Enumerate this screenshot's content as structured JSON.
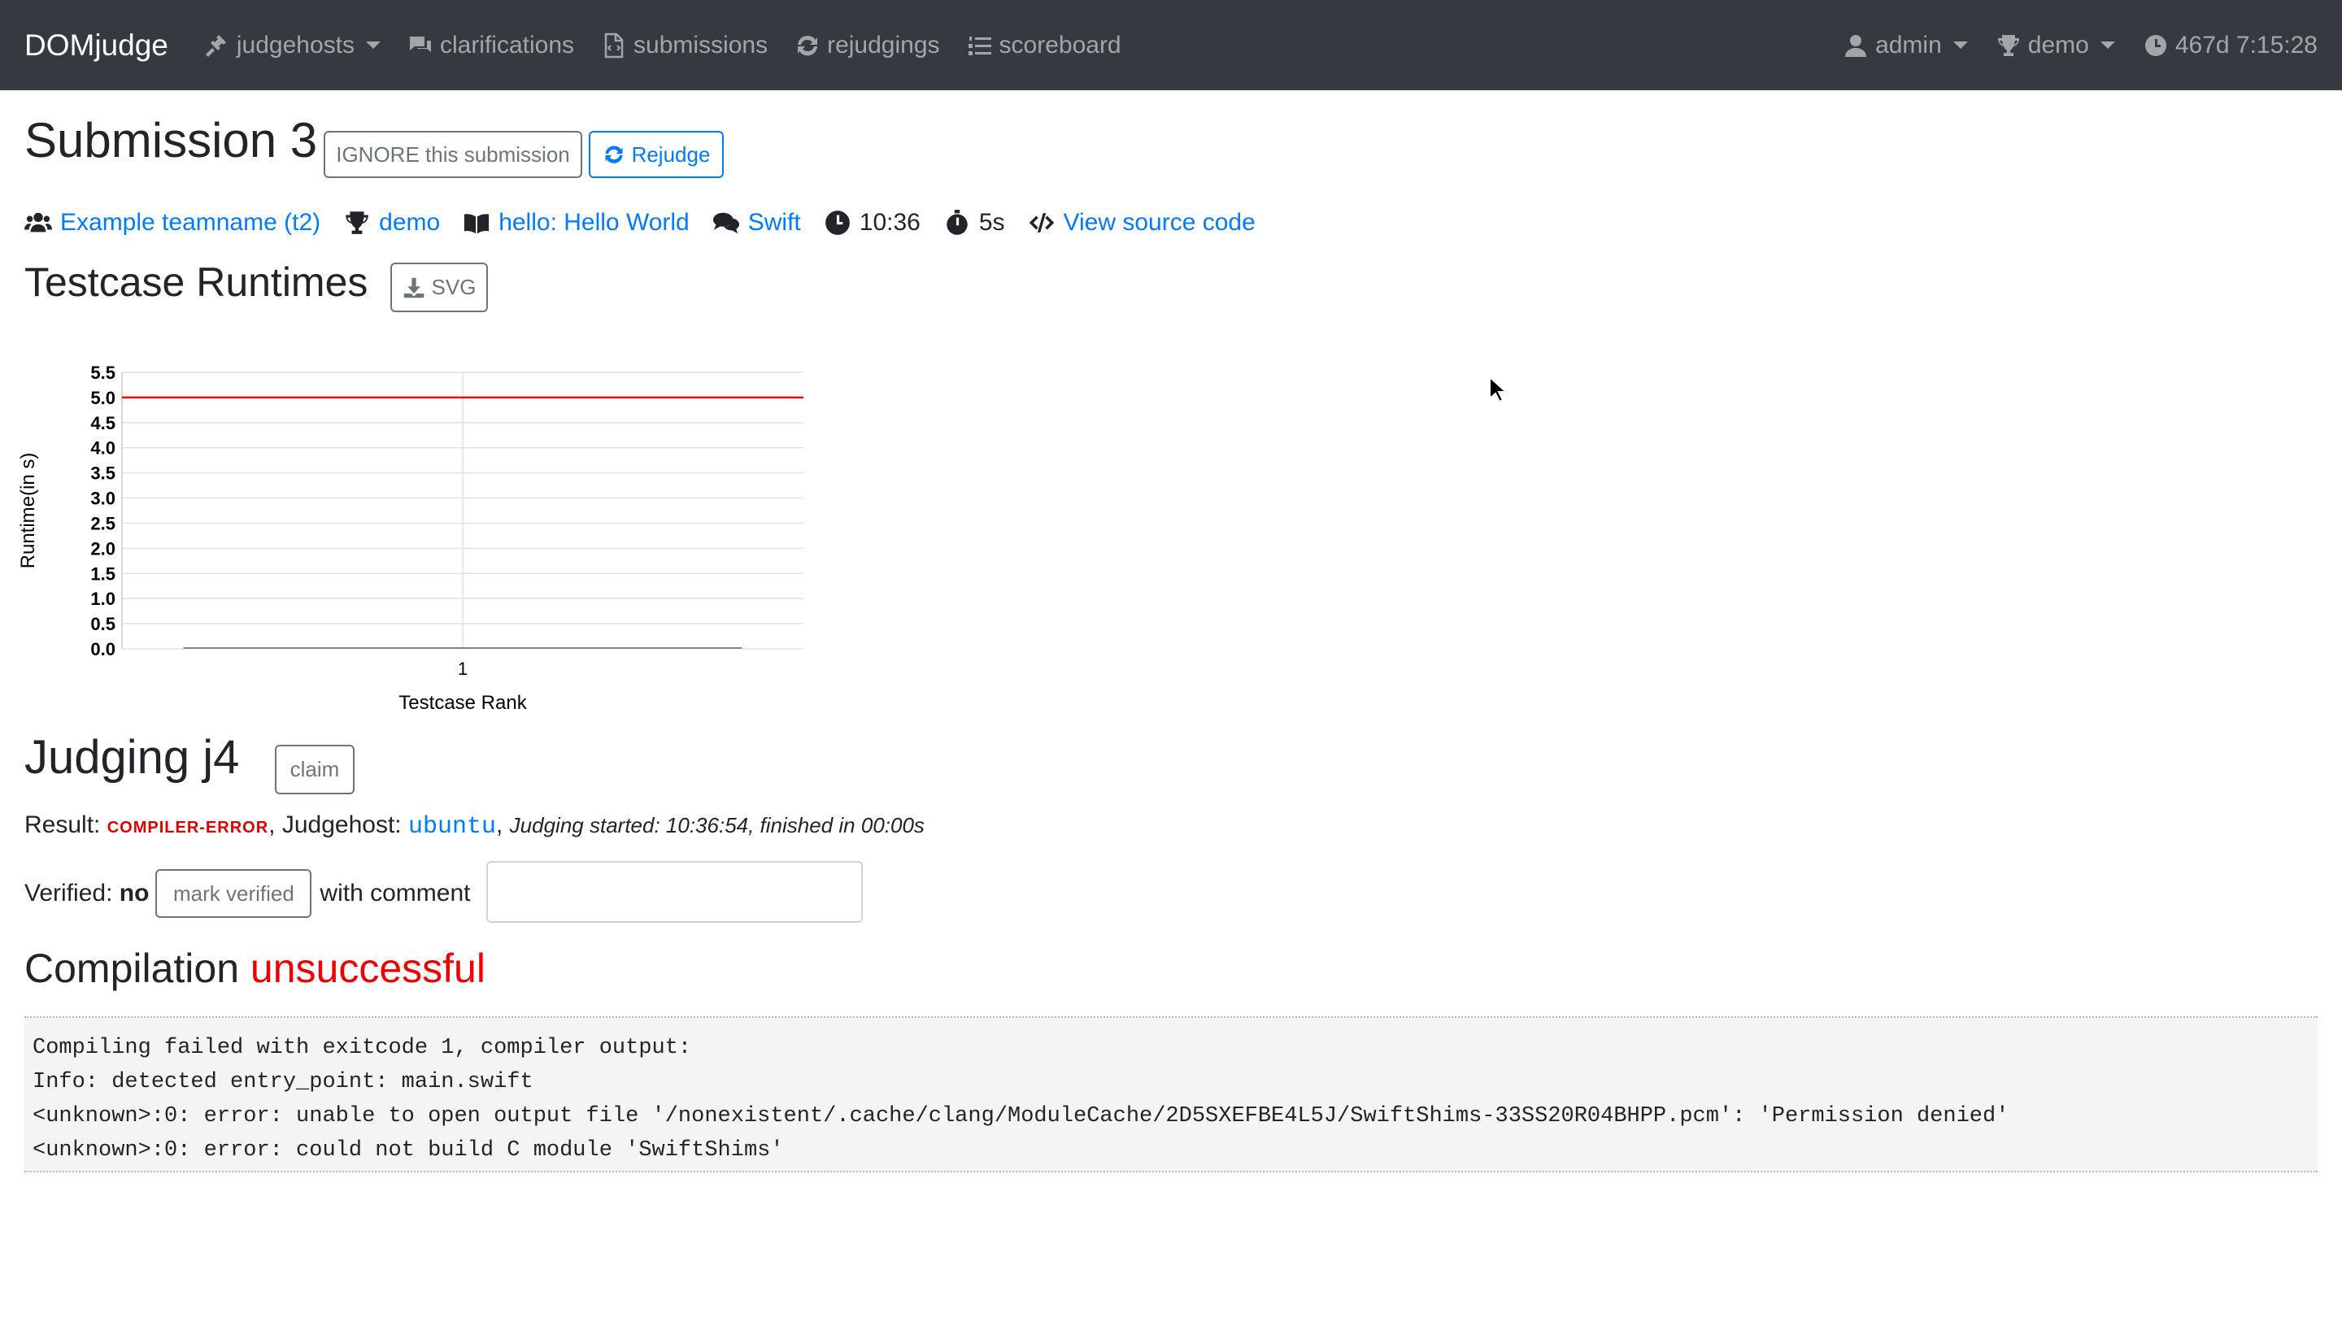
{
  "navbar": {
    "brand": "DOMjudge",
    "items": [
      {
        "label": "judgehosts",
        "icon": "gavel-icon",
        "dropdown": true
      },
      {
        "label": "clarifications",
        "icon": "comments-icon"
      },
      {
        "label": "submissions",
        "icon": "file-code-icon"
      },
      {
        "label": "rejudgings",
        "icon": "sync-icon"
      },
      {
        "label": "scoreboard",
        "icon": "list-ol-icon"
      }
    ],
    "user": "admin",
    "contest": "demo",
    "clock": "467d 7:15:28"
  },
  "submission": {
    "title": "Submission 3",
    "ignore_button": "IGNORE this submission",
    "rejudge_button": "Rejudge",
    "team": "Example teamname (t2)",
    "contest": "demo",
    "problem": "hello: Hello World",
    "language": "Swift",
    "time": "10:36",
    "runtime": "5s",
    "view_source": "View source code"
  },
  "runtimes": {
    "title": "Testcase Runtimes",
    "svg_button": "SVG"
  },
  "chart_data": {
    "type": "bar",
    "categories": [
      "1"
    ],
    "values": [
      0.0
    ],
    "timelimit": 5.0,
    "xlabel": "Testcase Rank",
    "ylabel": "Runtime(in s)",
    "ylim": [
      0,
      5.5
    ],
    "yticks": [
      "0.0",
      "0.5",
      "1.0",
      "1.5",
      "2.0",
      "2.5",
      "3.0",
      "3.5",
      "4.0",
      "4.5",
      "5.0",
      "5.5"
    ],
    "grid": true,
    "colors": {
      "limit": "#ff0000",
      "bar": "#888888"
    }
  },
  "judging": {
    "title": "Judging j4",
    "claim_button": "claim",
    "result_label": "Result:",
    "result": "compiler-error",
    "judgehost_label": "Judgehost:",
    "judgehost": "ubuntu",
    "started": "Judging started: 10:36:54, finished in 00:00s",
    "verified_label": "Verified:",
    "verified_value": "no",
    "mark_verified": "mark verified",
    "with_comment": "with comment"
  },
  "compilation": {
    "title": "Compilation",
    "status": "unsuccessful",
    "output": [
      "Compiling failed with exitcode 1, compiler output:",
      "Info: detected entry_point: main.swift",
      "<unknown>:0: error: unable to open output file '/nonexistent/.cache/clang/ModuleCache/2D5SXEFBE4L5J/SwiftShims-33SS20R04BHPP.pcm': 'Permission denied'",
      "<unknown>:0: error: could not build C module 'SwiftShims'"
    ]
  },
  "colors": {
    "navbar": "#343a40",
    "link": "#007bff",
    "error": "#dc0000"
  }
}
